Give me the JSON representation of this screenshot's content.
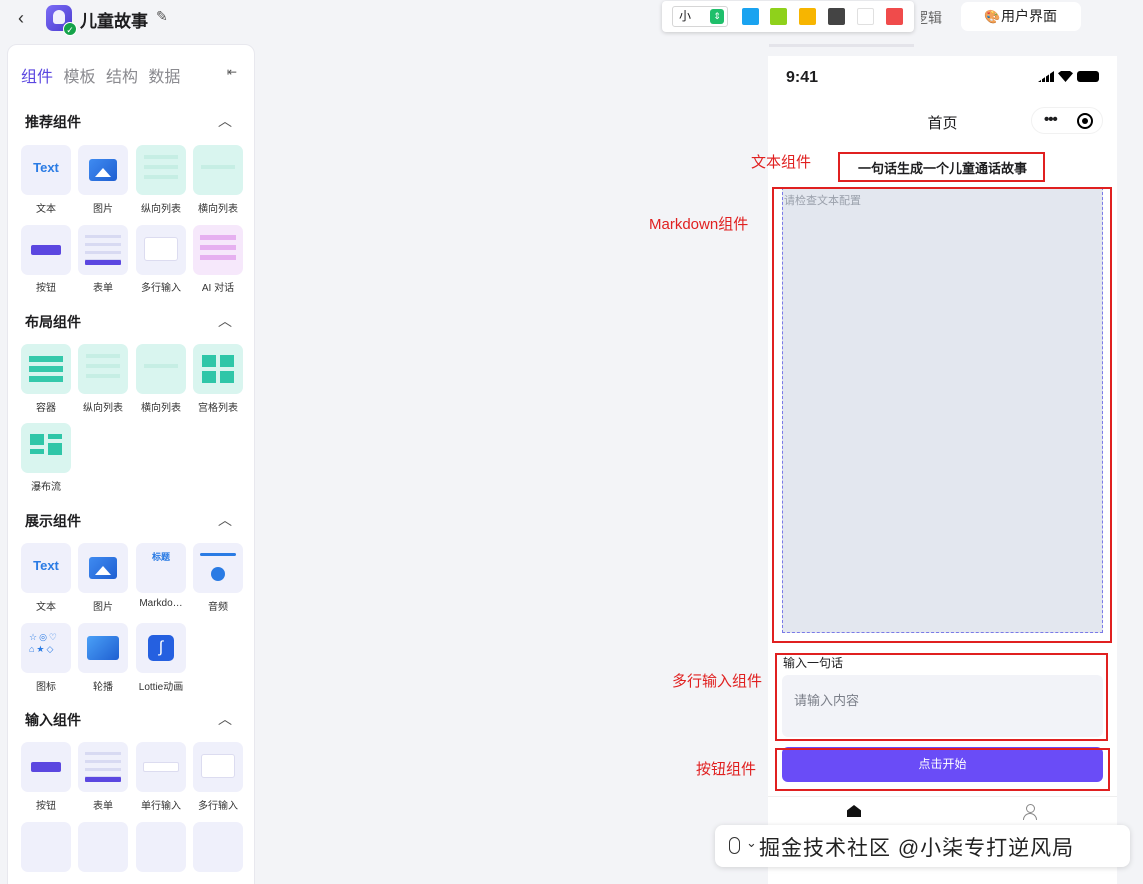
{
  "header": {
    "app_title": "儿童故事",
    "size_value": "小",
    "colors": [
      "#1aa3f0",
      "#8fd11b",
      "#f7b500",
      "#444444",
      "#ffffff",
      "#f04b4b"
    ],
    "tab_logic": "逻辑",
    "tab_ui": "用户界面"
  },
  "panel": {
    "tabs": [
      "组件",
      "模板",
      "结构",
      "数据"
    ],
    "sections": [
      {
        "title": "推荐组件",
        "items": [
          "文本",
          "图片",
          "纵向列表",
          "横向列表",
          "按钮",
          "表单",
          "多行输入",
          "AI 对话"
        ]
      },
      {
        "title": "布局组件",
        "items": [
          "容器",
          "纵向列表",
          "横向列表",
          "宫格列表",
          "瀑布流"
        ]
      },
      {
        "title": "展示组件",
        "items": [
          "文本",
          "图片",
          "Markdo…",
          "音频",
          "图标",
          "轮播",
          "Lottie动画"
        ]
      },
      {
        "title": "输入组件",
        "items": [
          "按钮",
          "表单",
          "单行输入",
          "多行输入"
        ]
      }
    ],
    "tile_text": "Text",
    "tile_md": "标题"
  },
  "phone": {
    "time": "9:41",
    "nav_title": "首页",
    "text_component": "一句话生成一个儿童通话故事",
    "markdown_placeholder": "请检查文本配置",
    "input_label": "输入一句话",
    "input_placeholder": "请输入内容",
    "button_label": "点击开始"
  },
  "annotations": {
    "text": "文本组件",
    "markdown": "Markdown组件",
    "multiline": "多行输入组件",
    "button": "按钮组件"
  },
  "watermark": "掘金技术社区 @小柒专打逆风局"
}
